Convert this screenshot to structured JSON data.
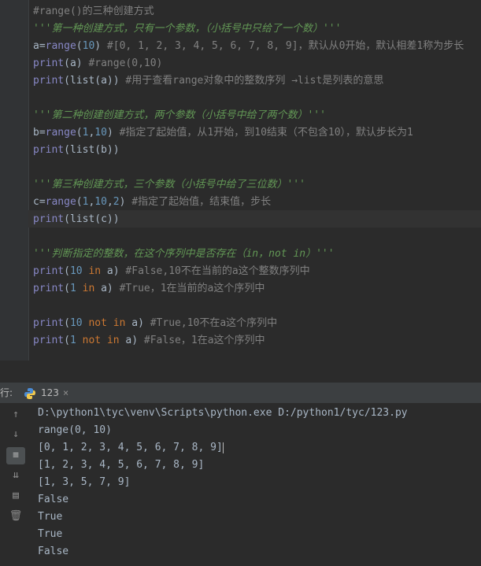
{
  "editor": {
    "lines": [
      {
        "text": "#range()的三种创建方式",
        "kind": "comment"
      },
      {
        "text": "'''第一种创建方式，只有一个参数，（小括号中只给了一个数）'''",
        "kind": "doc"
      },
      {
        "pre": "a=",
        "fn": "range",
        "args": "(10)",
        "comment": " #[0, 1, 2, 3, 4, 5, 6, 7, 8, 9]，默认从0开始，默认相差1称为步长"
      },
      {
        "fn": "print",
        "args": "(a)",
        "comment": " #range(0,10)"
      },
      {
        "fn": "print",
        "args": "(list(a))",
        "comment": " #用于查看range对象中的整数序列 →list是列表的意思"
      },
      {
        "text": "",
        "kind": "blank"
      },
      {
        "text": "'''第二种创建创建方式，两个参数（小括号中给了两个数）'''",
        "kind": "doc"
      },
      {
        "pre": "b=",
        "fn": "range",
        "args": "(1,10)",
        "comment": " #指定了起始值，从1开始，到10结束（不包含10），默认步长为1"
      },
      {
        "fn": "print",
        "args": "(list(b))"
      },
      {
        "text": "",
        "kind": "blank"
      },
      {
        "text": "'''第三种创建方式，三个参数（小括号中给了三位数）'''",
        "kind": "doc"
      },
      {
        "pre": "c=",
        "fn": "range",
        "args": "(1,10,2)",
        "comment": " #指定了起始值，结束值，步长"
      },
      {
        "fn": "print",
        "args": "(list(c))"
      },
      {
        "text": "",
        "kind": "blank"
      },
      {
        "text": "'''判断指定的整数，在这个序列中是否存在（in，not in）'''",
        "kind": "doc"
      },
      {
        "fn": "print",
        "args": "(10 in a)",
        "comment": " #False,10不在当前的a这个整数序列中"
      },
      {
        "fn": "print",
        "args": "(1 in a)",
        "comment": " #True，1在当前的a这个序列中"
      },
      {
        "text": "",
        "kind": "blank"
      },
      {
        "fn": "print",
        "args": "(10 not in a)",
        "comment": " #True,10不在a这个序列中"
      },
      {
        "fn": "print",
        "args": "(1 not in a)",
        "comment": " #False，1在a这个序列中"
      }
    ]
  },
  "run_panel": {
    "left_label": "行:",
    "tab_label": "123",
    "close_glyph": "×",
    "output": [
      "D:\\python1\\tyc\\venv\\Scripts\\python.exe D:/python1/tyc/123.py",
      "range(0, 10)",
      "[0, 1, 2, 3, 4, 5, 6, 7, 8, 9]",
      "[1, 2, 3, 4, 5, 6, 7, 8, 9]",
      "[1, 3, 5, 7, 9]",
      "False",
      "True",
      "True",
      "False"
    ],
    "tools": [
      "arrow-up-icon",
      "arrow-down-icon",
      "soft-wrap-icon",
      "scroll-to-end-icon",
      "print-icon",
      "trash-icon"
    ]
  }
}
